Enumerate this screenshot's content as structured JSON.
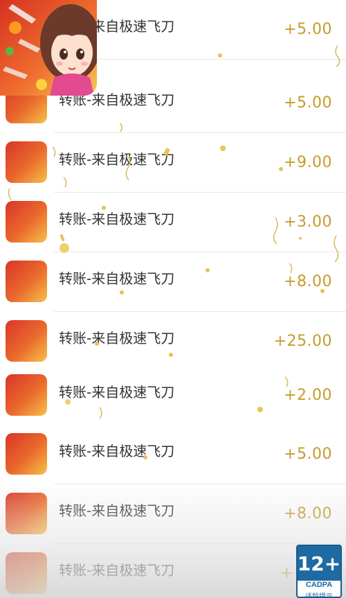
{
  "items": [
    {
      "title": "转账-来自极速飞刀",
      "amount": "+5.00"
    },
    {
      "title": "转账-来自极速飞刀",
      "amount": "+5.00"
    },
    {
      "title": "转账-来自极速飞刀",
      "amount": "+9.00"
    },
    {
      "title": "转账-来自极速飞刀",
      "amount": "+3.00"
    },
    {
      "title": "转账-来自极速飞刀",
      "amount": "+8.00"
    },
    {
      "title": "转账-来自极速飞刀",
      "amount": "+25.00"
    },
    {
      "title": "转账-来自极速飞刀",
      "amount": "+2.00"
    },
    {
      "title": "转账-来自极速飞刀",
      "amount": "+5.00"
    },
    {
      "title": "转账-来自极速飞刀",
      "amount": "+8.00"
    },
    {
      "title": "转账-来自极速飞刀",
      "amount": "+"
    }
  ],
  "badge": {
    "age": "12+",
    "org": "CADPA",
    "tip": "适龄提示"
  },
  "colors": {
    "amount": "#c59b2a",
    "title": "#333333",
    "badge": "#1e6aa3"
  },
  "icons": {
    "app": "game-character-icon"
  }
}
